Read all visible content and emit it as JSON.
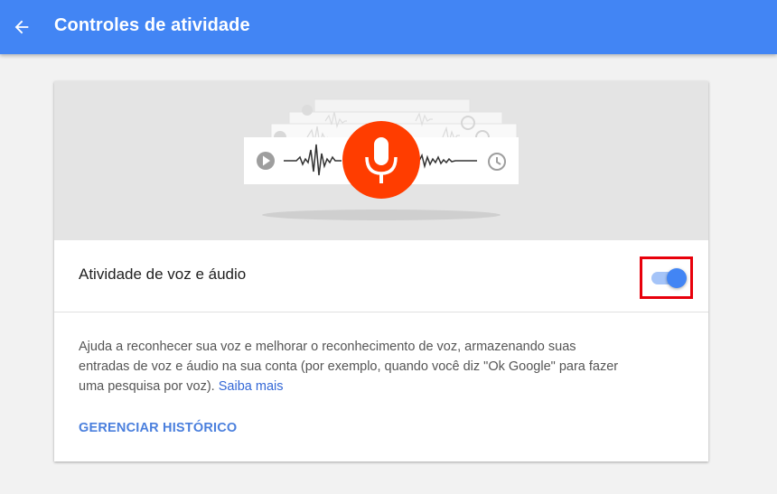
{
  "appbar": {
    "title": "Controles de atividade",
    "back_icon": "arrow-back-icon",
    "background_color": "#4285f4"
  },
  "hero": {
    "icons": [
      "play-icon",
      "microphone-icon",
      "clock-icon",
      "waveform"
    ],
    "mic_color": "#ff3d00"
  },
  "setting": {
    "label": "Atividade de voz e áudio",
    "enabled": true,
    "toggle_color": "#4285f4",
    "highlight_color": "#e8000b"
  },
  "description": {
    "text": "Ajuda a reconhecer sua voz e melhorar o reconhecimento de voz, armazenando suas entradas de voz e áudio na sua conta (por exemplo, quando você diz \"Ok Google\" para fazer uma pesquisa por voz).",
    "link_label": "Saiba mais"
  },
  "actions": {
    "manage_label": "GERENCIAR HISTÓRICO"
  }
}
